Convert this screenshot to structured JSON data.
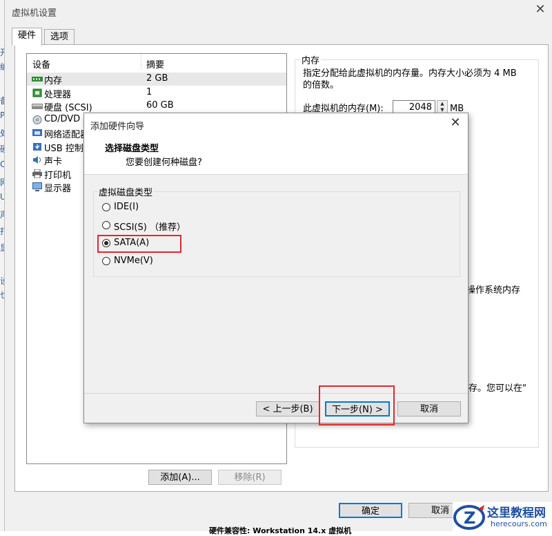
{
  "left_strip_chars": [
    "开",
    "编",
    "备",
    "P",
    "处",
    "硬",
    "C",
    "网",
    "U",
    "声",
    "打",
    "显",
    "设",
    "也"
  ],
  "main": {
    "title": "虚拟机设置",
    "tabs": [
      {
        "label": "硬件"
      },
      {
        "label": "选项"
      }
    ],
    "device_list": {
      "headers": [
        "设备",
        "摘要"
      ],
      "rows": [
        {
          "name": "内存",
          "value": "2 GB",
          "icon": "memory-icon"
        },
        {
          "name": "处理器",
          "value": "1",
          "icon": "cpu-icon"
        },
        {
          "name": "硬盘 (SCSI)",
          "value": "60 GB",
          "icon": "harddisk-icon"
        },
        {
          "name": "CD/DVD (S",
          "value": "",
          "icon": "cd-icon"
        },
        {
          "name": "网络适配器",
          "value": "",
          "icon": "network-icon"
        },
        {
          "name": "USB 控制器",
          "value": "",
          "icon": "usb-icon"
        },
        {
          "name": "声卡",
          "value": "",
          "icon": "sound-icon"
        },
        {
          "name": "打印机",
          "value": "",
          "icon": "printer-icon"
        },
        {
          "name": "显示器",
          "value": "",
          "icon": "display-icon"
        }
      ]
    },
    "add_button": "添加(A)...",
    "remove_button": "移除(R)",
    "memory_group_label": "内存",
    "memory_desc_1": "指定分配给此虚拟机的内存量。内存大小必须为 4 MB",
    "memory_desc_2": "的倍数。",
    "memory_field_label": "此虚拟机的内存(M):",
    "memory_value": "2048",
    "memory_unit": "MB",
    "right_frag_1": "操作系统内存",
    "right_frag_2": "存。您可以在\"",
    "ok_button": "确定",
    "cancel_button": "取消",
    "bottom_frag": "硬件兼容性: Workstation 14.x 虚拟机"
  },
  "wizard": {
    "title": "添加硬件向导",
    "heading": "选择磁盘类型",
    "subheading": "您要创建何种磁盘?",
    "group_label": "虚拟磁盘类型",
    "options": [
      {
        "label": "IDE(I)",
        "selected": false
      },
      {
        "label": "SCSI(S) （推荐）",
        "selected": false
      },
      {
        "label": "SATA(A)",
        "selected": true
      },
      {
        "label": "NVMe(V)",
        "selected": false
      }
    ],
    "back_button": "< 上一步(B)",
    "next_button": "下一步(N) >",
    "cancel_button": "取消"
  },
  "watermark": {
    "cn": "这里教程网",
    "url": "herecours.com",
    "letter": "Z"
  },
  "colors": {
    "highlight_red": "#e0282d",
    "primary_blue": "#0078d7",
    "dialog_bg": "#f0f0f0"
  }
}
